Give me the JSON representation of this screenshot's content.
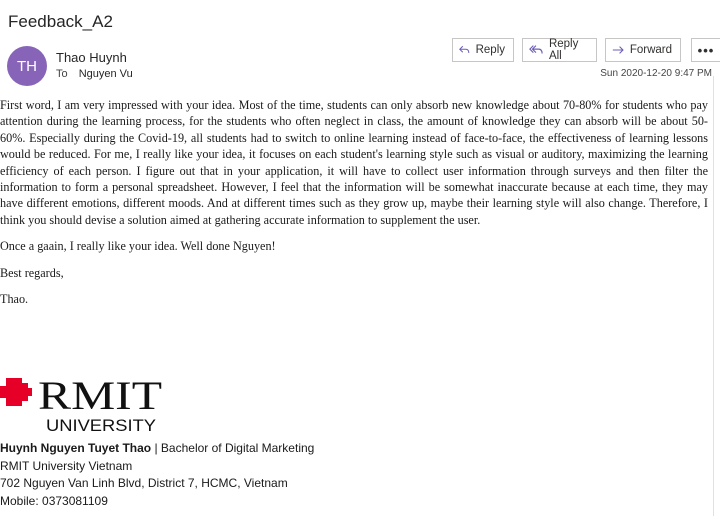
{
  "email": {
    "subject": "Feedback_A2",
    "avatar_initials": "TH",
    "sender_name": "Thao Huynh",
    "to_label": "To",
    "to_name": "Nguyen Vu",
    "date": "Sun 2020-12-20 9:47 PM",
    "colors": {
      "avatar": "#8764b8",
      "icon_accent": "#6b5fb5"
    }
  },
  "actions": {
    "reply": "Reply",
    "reply_all": "Reply All",
    "forward": "Forward",
    "more": "•••"
  },
  "body": {
    "paragraphs": [
      "First word, I am very impressed with your idea. Most of the time, students can only absorb new knowledge about 70-80% for students who pay attention during the learning process, for the students who often neglect in class, the amount of knowledge they can absorb will be about 50-60%. Especially during the Covid-19, all students had to switch to online learning instead of face-to-face, the effectiveness of learning lessons would be reduced. For me, I really like your idea, it focuses on each student's learning style such as visual or auditory, maximizing the learning efficiency of each person. I figure out that in your application, it will have to collect user information through surveys and then filter the information to form a personal spreadsheet. However, I feel that the information will be somewhat inaccurate because at each time, they may have different emotions, different moods. And at different times such as they grow up, maybe their learning style will also change. Therefore, I think you should devise a solution aimed at gathering accurate information to supplement the user.",
      "Once a gaain, I really like your idea. Well done Nguyen!",
      "Best regards,",
      "Thao."
    ]
  },
  "logo": {
    "line1": "RMIT",
    "line2": "UNIVERSITY",
    "color": "#e60028"
  },
  "signature": {
    "name": "Huynh Nguyen Tuyet Thao",
    "separator": " | ",
    "title": "Bachelor of Digital Marketing",
    "org": "RMIT University Vietnam",
    "address": "702 Nguyen Van Linh Blvd, District 7, HCMC, Vietnam",
    "mobile": "Mobile: 0373081109"
  }
}
